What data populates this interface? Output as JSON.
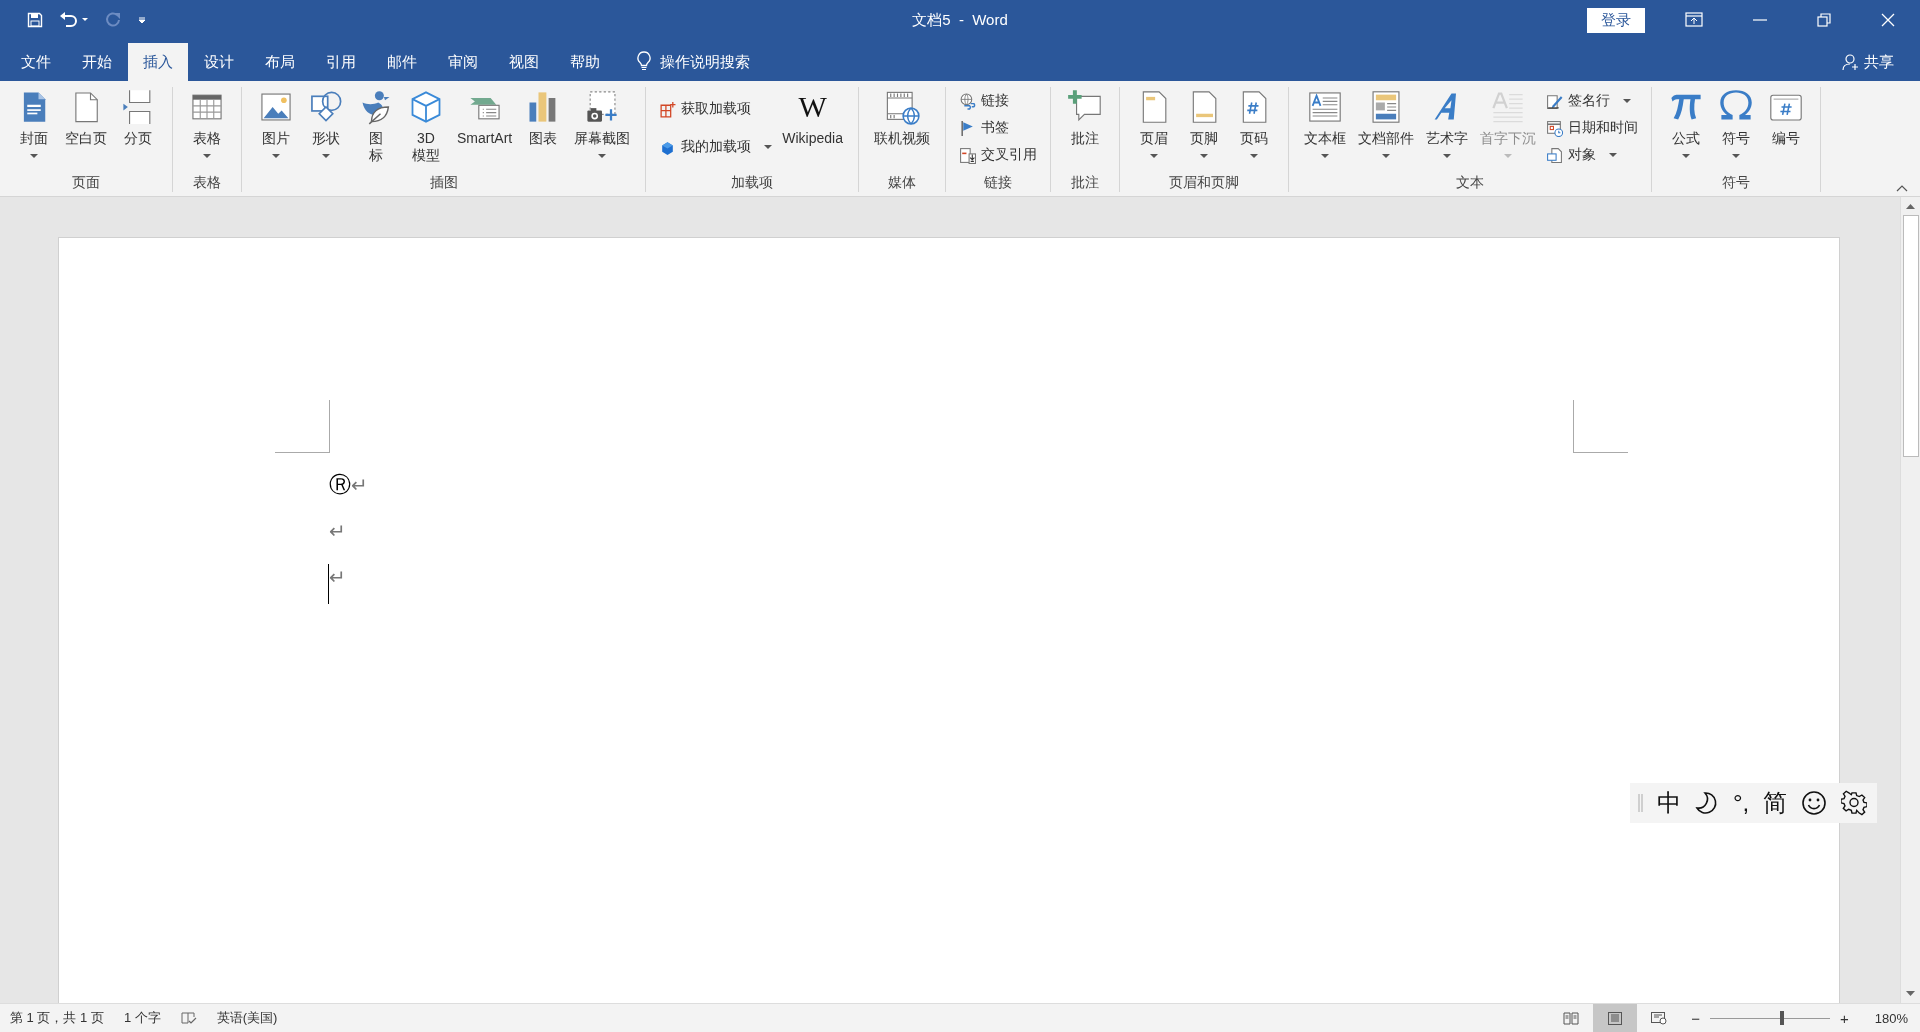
{
  "title_bar": {
    "title": "文档5  -  Word",
    "login": "登录"
  },
  "tabs": [
    {
      "label": "文件",
      "selected": false
    },
    {
      "label": "开始",
      "selected": false
    },
    {
      "label": "插入",
      "selected": true
    },
    {
      "label": "设计",
      "selected": false
    },
    {
      "label": "布局",
      "selected": false
    },
    {
      "label": "引用",
      "selected": false
    },
    {
      "label": "邮件",
      "selected": false
    },
    {
      "label": "审阅",
      "selected": false
    },
    {
      "label": "视图",
      "selected": false
    },
    {
      "label": "帮助",
      "selected": false
    }
  ],
  "tell_me": "操作说明搜索",
  "share": "共享",
  "ribbon": {
    "groups": [
      {
        "label": "页面",
        "items": [
          {
            "kind": "large",
            "label": "封面",
            "dropdown": true,
            "disabled": false
          },
          {
            "kind": "large",
            "label": "空白页",
            "dropdown": false,
            "disabled": false
          },
          {
            "kind": "large",
            "label": "分页",
            "dropdown": false,
            "disabled": false
          }
        ]
      },
      {
        "label": "表格",
        "items": [
          {
            "kind": "large",
            "label": "表格",
            "dropdown": true,
            "disabled": false
          }
        ]
      },
      {
        "label": "插图",
        "items": [
          {
            "kind": "large",
            "label": "图片",
            "dropdown": true,
            "disabled": false
          },
          {
            "kind": "large",
            "label": "形状",
            "dropdown": true,
            "disabled": false
          },
          {
            "kind": "large",
            "lines": [
              "图",
              "标"
            ],
            "dropdown": false,
            "disabled": false
          },
          {
            "kind": "large",
            "lines": [
              "3D",
              "模型"
            ],
            "dropdown": false,
            "disabled": false
          },
          {
            "kind": "large",
            "label": "SmartArt",
            "dropdown": false,
            "disabled": false
          },
          {
            "kind": "large",
            "label": "图表",
            "dropdown": false,
            "disabled": false
          },
          {
            "kind": "large",
            "label": "屏幕截图",
            "dropdown": true,
            "disabled": false
          }
        ]
      },
      {
        "label": "加载项",
        "items": [
          {
            "kind": "stack",
            "items": [
              {
                "label": "获取加载项",
                "dropdown": false,
                "disabled": false
              },
              {
                "label": "我的加载项",
                "dropdown": true,
                "disabled": false
              }
            ]
          },
          {
            "kind": "logo",
            "logo": "W",
            "label": "Wikipedia",
            "dropdown": false,
            "disabled": false
          }
        ]
      },
      {
        "label": "媒体",
        "items": [
          {
            "kind": "large",
            "label": "联机视频",
            "dropdown": false,
            "disabled": false
          }
        ]
      },
      {
        "label": "链接",
        "items": [
          {
            "kind": "stack",
            "items": [
              {
                "label": "链接",
                "dropdown": false,
                "disabled": false
              },
              {
                "label": "书签",
                "dropdown": false,
                "disabled": false
              },
              {
                "label": "交叉引用",
                "dropdown": false,
                "disabled": false
              }
            ]
          }
        ]
      },
      {
        "label": "批注",
        "items": [
          {
            "kind": "large",
            "label": "批注",
            "dropdown": false,
            "disabled": false
          }
        ]
      },
      {
        "label": "页眉和页脚",
        "items": [
          {
            "kind": "large",
            "label": "页眉",
            "dropdown": true,
            "disabled": false
          },
          {
            "kind": "large",
            "label": "页脚",
            "dropdown": true,
            "disabled": false
          },
          {
            "kind": "large",
            "label": "页码",
            "dropdown": true,
            "disabled": false
          }
        ]
      },
      {
        "label": "文本",
        "items": [
          {
            "kind": "large",
            "label": "文本框",
            "dropdown": true,
            "disabled": false
          },
          {
            "kind": "large",
            "label": "文档部件",
            "dropdown": true,
            "disabled": false
          },
          {
            "kind": "large",
            "label": "艺术字",
            "dropdown": true,
            "disabled": false
          },
          {
            "kind": "large",
            "label": "首字下沉",
            "dropdown": true,
            "disabled": true
          },
          {
            "kind": "stack",
            "items": [
              {
                "label": "签名行",
                "dropdown": true,
                "disabled": false
              },
              {
                "label": "日期和时间",
                "dropdown": false,
                "disabled": false
              },
              {
                "label": "对象",
                "dropdown": true,
                "disabled": false
              }
            ]
          }
        ]
      },
      {
        "label": "符号",
        "items": [
          {
            "kind": "large",
            "label": "公式",
            "dropdown": true,
            "disabled": false
          },
          {
            "kind": "large",
            "label": "符号",
            "dropdown": true,
            "disabled": false
          },
          {
            "kind": "large",
            "label": "编号",
            "dropdown": false,
            "disabled": false
          }
        ]
      }
    ]
  },
  "document": {
    "paragraphs": [
      {
        "text": "Ⓡ",
        "mark": "↵",
        "cursor": false
      },
      {
        "mark": "↵",
        "cursor": false
      },
      {
        "mark": "↵",
        "cursor": true
      }
    ]
  },
  "ime_toolbar": {
    "labels": [
      "中",
      "°,",
      "简"
    ]
  },
  "status_bar": {
    "page": "第 1 页，共 1 页",
    "words": "1 个字",
    "language": "英语(美国)",
    "views": [
      {
        "selected": false
      },
      {
        "selected": true
      },
      {
        "selected": false
      }
    ],
    "zoom": {
      "minus": "−",
      "plus": "+",
      "level": 0.6,
      "reading": "180%"
    }
  }
}
